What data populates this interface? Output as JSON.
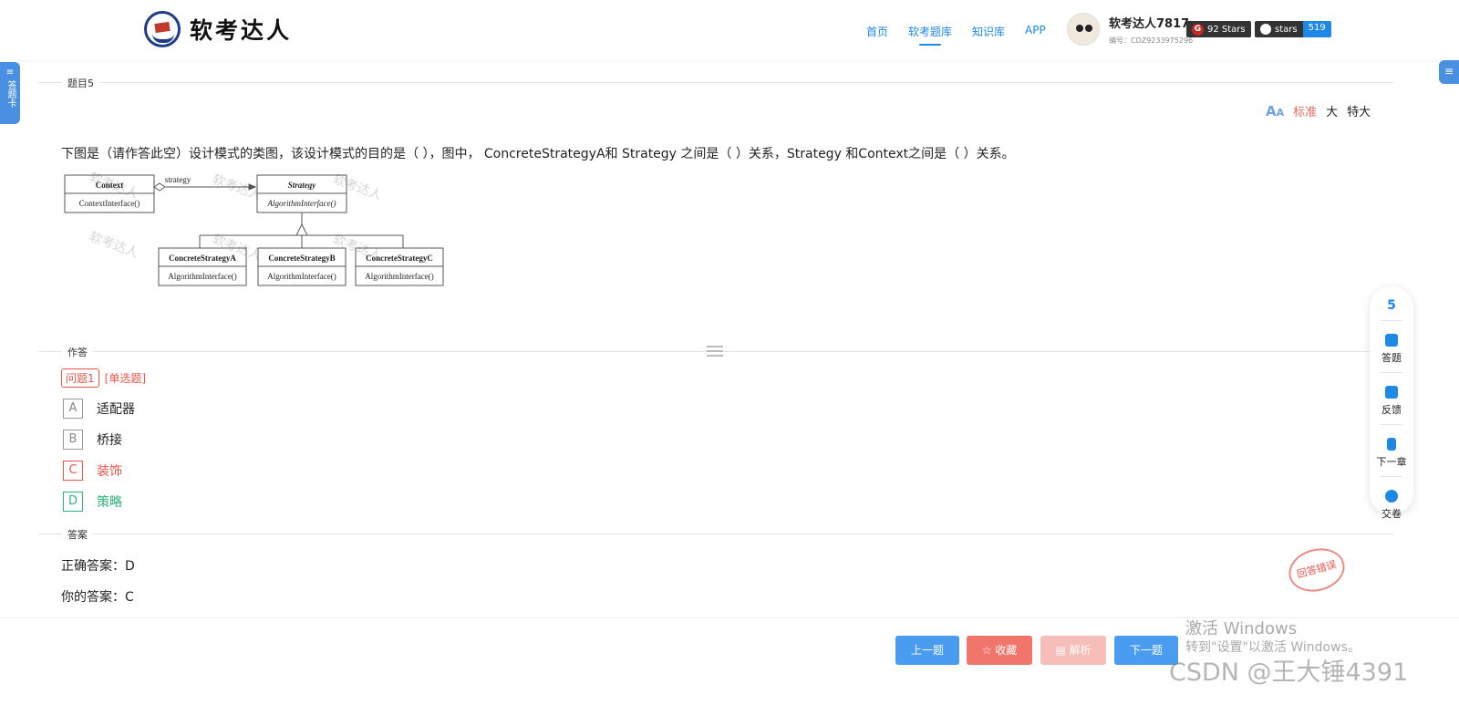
{
  "header": {
    "logo_text": "软考达人",
    "nav": [
      "首页",
      "软考题库",
      "知识库",
      "APP"
    ],
    "active_nav_index": 1,
    "user_name": "软考达人7817",
    "user_id": "编号：CDZ9233975296",
    "badge_gitee": "92 Stars",
    "badge_github_label": "stars",
    "badge_github_count": "519"
  },
  "sidebar": {
    "left_tab": "答题卡"
  },
  "question_section": {
    "label": "题目5",
    "font_sizes": [
      "标准",
      "大",
      "特大"
    ],
    "question_text": "下图是（请作答此空）设计模式的类图，该设计模式的目的是（ ），图中， ConcreteStrategyA和 Strategy 之间是（ ）关系，Strategy 和Context之间是（ ）关系。",
    "diagram": {
      "context_title": "Context",
      "context_method": "ContextInterface()",
      "association_label": "strategy",
      "strategy_title": "Strategy",
      "strategy_method": "AlgorithmInterface()",
      "concrete": [
        {
          "title": "ConcreteStrategyA",
          "method": "AlgorithmInterface()"
        },
        {
          "title": "ConcreteStrategyB",
          "method": "AlgorithmInterface()"
        },
        {
          "title": "ConcreteStrategyC",
          "method": "AlgorithmInterface()"
        }
      ],
      "watermark": "软考达人"
    }
  },
  "answer_section": {
    "label": "作答",
    "question_tag": "问题1",
    "question_type": "[单选题]",
    "options": [
      {
        "key": "A",
        "text": "适配器",
        "state": "normal"
      },
      {
        "key": "B",
        "text": "桥接",
        "state": "normal"
      },
      {
        "key": "C",
        "text": "装饰",
        "state": "wrong"
      },
      {
        "key": "D",
        "text": "策略",
        "state": "correct"
      }
    ]
  },
  "result_section": {
    "label": "答案",
    "correct_answer": "正确答案：D",
    "your_answer": "你的答案：C",
    "stamp": "回答错误"
  },
  "float_panel": {
    "number": "5",
    "items": [
      "答题",
      "反馈",
      "下一章",
      "交卷"
    ]
  },
  "footer": {
    "prev": "上一题",
    "favorite": "☆ 收藏",
    "analysis": "▤ 解析",
    "next": "下一题"
  },
  "watermarks": {
    "activate_title": "激活 Windows",
    "activate_sub": "转到\"设置\"以激活 Windows。",
    "csdn": "CSDN @王大锤4391"
  },
  "colors": {
    "primary": "#1e88e5",
    "wrong": "#e8554b",
    "correct": "#2bb67d"
  }
}
